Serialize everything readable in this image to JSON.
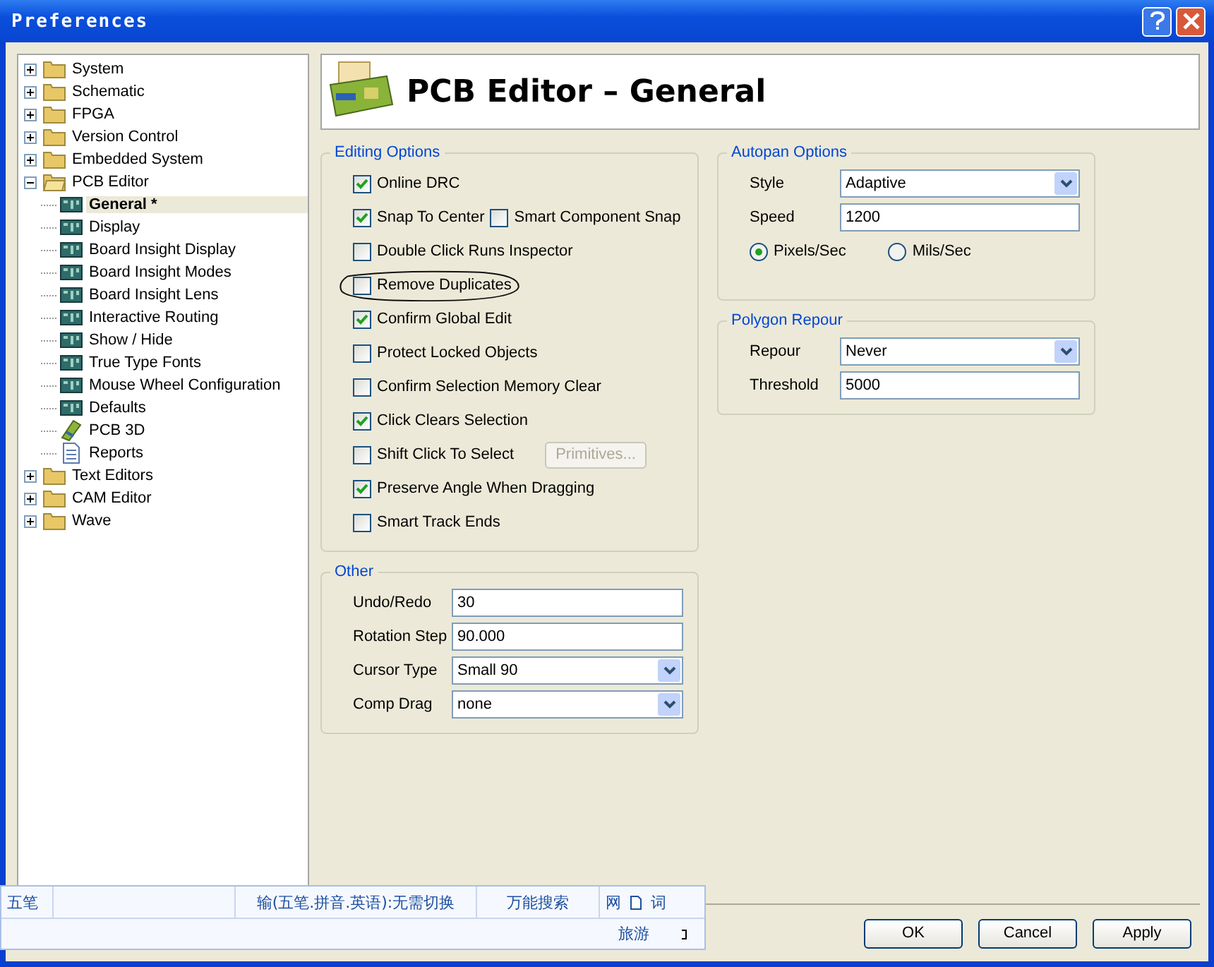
{
  "window": {
    "title": "Preferences"
  },
  "tree": [
    {
      "label": "System",
      "kind": "folder",
      "expanded": false,
      "selected": false
    },
    {
      "label": "Schematic",
      "kind": "folder",
      "expanded": false,
      "selected": false
    },
    {
      "label": "FPGA",
      "kind": "folder",
      "expanded": false,
      "selected": false
    },
    {
      "label": "Version Control",
      "kind": "folder",
      "expanded": false,
      "selected": false
    },
    {
      "label": "Embedded System",
      "kind": "folder",
      "expanded": false,
      "selected": false
    },
    {
      "label": "PCB Editor",
      "kind": "folder",
      "expanded": true,
      "selected": false,
      "children": [
        {
          "label": "General *",
          "kind": "board",
          "selected": true
        },
        {
          "label": "Display",
          "kind": "board",
          "selected": false
        },
        {
          "label": "Board Insight Display",
          "kind": "board",
          "selected": false
        },
        {
          "label": "Board Insight Modes",
          "kind": "board",
          "selected": false
        },
        {
          "label": "Board Insight Lens",
          "kind": "board",
          "selected": false
        },
        {
          "label": "Interactive Routing",
          "kind": "board",
          "selected": false
        },
        {
          "label": "Show / Hide",
          "kind": "board",
          "selected": false
        },
        {
          "label": "True Type Fonts",
          "kind": "board",
          "selected": false
        },
        {
          "label": "Mouse Wheel Configuration",
          "kind": "board",
          "selected": false
        },
        {
          "label": "Defaults",
          "kind": "board",
          "selected": false
        },
        {
          "label": "PCB 3D",
          "kind": "pcb3d",
          "selected": false
        },
        {
          "label": "Reports",
          "kind": "report",
          "selected": false
        }
      ]
    },
    {
      "label": "Text Editors",
      "kind": "folder",
      "expanded": false,
      "selected": false
    },
    {
      "label": "CAM Editor",
      "kind": "folder",
      "expanded": false,
      "selected": false
    },
    {
      "label": "Wave",
      "kind": "folder",
      "expanded": false,
      "selected": false
    }
  ],
  "header": {
    "title": "PCB Editor – General"
  },
  "editing_options": {
    "title": "Editing Options",
    "rows": [
      {
        "checks": [
          {
            "label": "Online DRC",
            "checked": true,
            "circled": false
          }
        ]
      },
      {
        "checks": [
          {
            "label": "Snap To Center",
            "checked": true,
            "circled": false
          },
          {
            "label": "Smart Component Snap",
            "checked": false,
            "circled": false
          }
        ]
      },
      {
        "checks": [
          {
            "label": "Double Click Runs Inspector",
            "checked": false,
            "circled": false
          }
        ]
      },
      {
        "checks": [
          {
            "label": "Remove Duplicates",
            "checked": false,
            "circled": true
          }
        ]
      },
      {
        "checks": [
          {
            "label": "Confirm Global Edit",
            "checked": true,
            "circled": false
          }
        ]
      },
      {
        "checks": [
          {
            "label": "Protect Locked Objects",
            "checked": false,
            "circled": false
          }
        ]
      },
      {
        "checks": [
          {
            "label": "Confirm Selection Memory Clear",
            "checked": false,
            "circled": false
          }
        ]
      },
      {
        "checks": [
          {
            "label": "Click Clears Selection",
            "checked": true,
            "circled": false
          }
        ]
      },
      {
        "checks": [
          {
            "label": "Shift Click To Select",
            "checked": false,
            "circled": false
          }
        ],
        "button": {
          "label": "Primitives...",
          "disabled": true
        }
      },
      {
        "checks": [
          {
            "label": "Preserve Angle When Dragging",
            "checked": true,
            "circled": false
          }
        ]
      },
      {
        "checks": [
          {
            "label": "Smart Track Ends",
            "checked": false,
            "circled": false
          }
        ]
      }
    ]
  },
  "other": {
    "title": "Other",
    "fields": [
      {
        "label": "Undo/Redo",
        "kind": "text",
        "value": "30"
      },
      {
        "label": "Rotation Step",
        "kind": "text",
        "value": "90.000"
      },
      {
        "label": "Cursor Type",
        "kind": "dropdown",
        "value": "Small 90"
      },
      {
        "label": "Comp Drag",
        "kind": "dropdown",
        "value": "none"
      }
    ]
  },
  "autopan_options": {
    "title": "Autopan Options",
    "fields": [
      {
        "label": "Style",
        "kind": "dropdown",
        "value": "Adaptive"
      },
      {
        "label": "Speed",
        "kind": "text",
        "value": "1200"
      }
    ],
    "radios": [
      {
        "label": "Pixels/Sec",
        "selected": true
      },
      {
        "label": "Mils/Sec",
        "selected": false
      }
    ]
  },
  "polygon_repour": {
    "title": "Polygon Repour",
    "fields": [
      {
        "label": "Repour",
        "kind": "dropdown",
        "value": "Never"
      },
      {
        "label": "Threshold",
        "kind": "text",
        "value": "5000"
      }
    ]
  },
  "buttons": [
    "OK",
    "Cancel",
    "Apply"
  ],
  "ime_bar": {
    "mode": "五笔",
    "hint": "输(五笔.拼音.英语):无需切换",
    "search": "万能搜索",
    "web": "网",
    "word": "词",
    "travel": "旅游"
  }
}
